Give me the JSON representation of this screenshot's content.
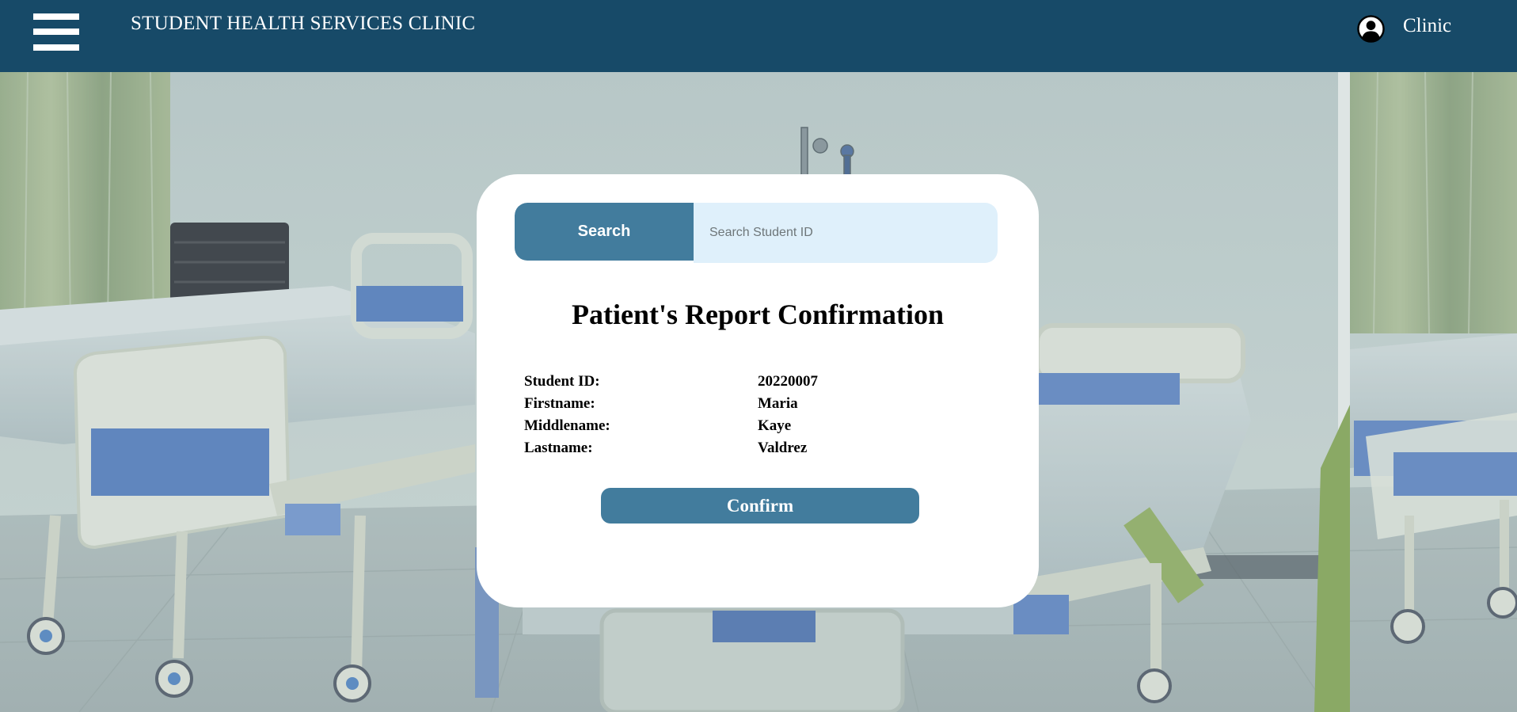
{
  "header": {
    "title": "STUDENT HEALTH SERVICES CLINIC",
    "user_label": "Clinic",
    "background_color": "#174a68"
  },
  "icons": {
    "menu": "hamburger-menu-icon",
    "user": "user-circle-icon"
  },
  "search": {
    "button_label": "Search",
    "placeholder": "Search Student ID",
    "value": ""
  },
  "report": {
    "title": "Patient's Report Confirmation",
    "fields": [
      {
        "label": "Student ID:",
        "value": "20220007"
      },
      {
        "label": "Firstname:",
        "value": "Maria"
      },
      {
        "label": "Middlename:",
        "value": "Kaye"
      },
      {
        "label": "Lastname:",
        "value": "Valdrez"
      }
    ],
    "confirm_label": "Confirm"
  },
  "colors": {
    "accent": "#427c9d",
    "input_background": "#dff0fb",
    "card_background": "#ffffff"
  },
  "background_image": "hospital-room-with-beds"
}
